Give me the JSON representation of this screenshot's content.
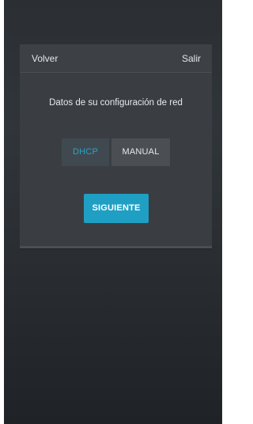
{
  "header": {
    "back_label": "Volver",
    "exit_label": "Salir"
  },
  "main": {
    "subtitle": "Datos de su configuración de red",
    "options": [
      {
        "label": "DHCP",
        "selected": true
      },
      {
        "label": "MANUAL",
        "selected": false
      }
    ],
    "next_label": "SIGUIENTE"
  },
  "colors": {
    "accent": "#1f9fc3",
    "selected_text": "#2aa3c6",
    "panel": "#3a3e42",
    "background": "#2b2f33"
  }
}
